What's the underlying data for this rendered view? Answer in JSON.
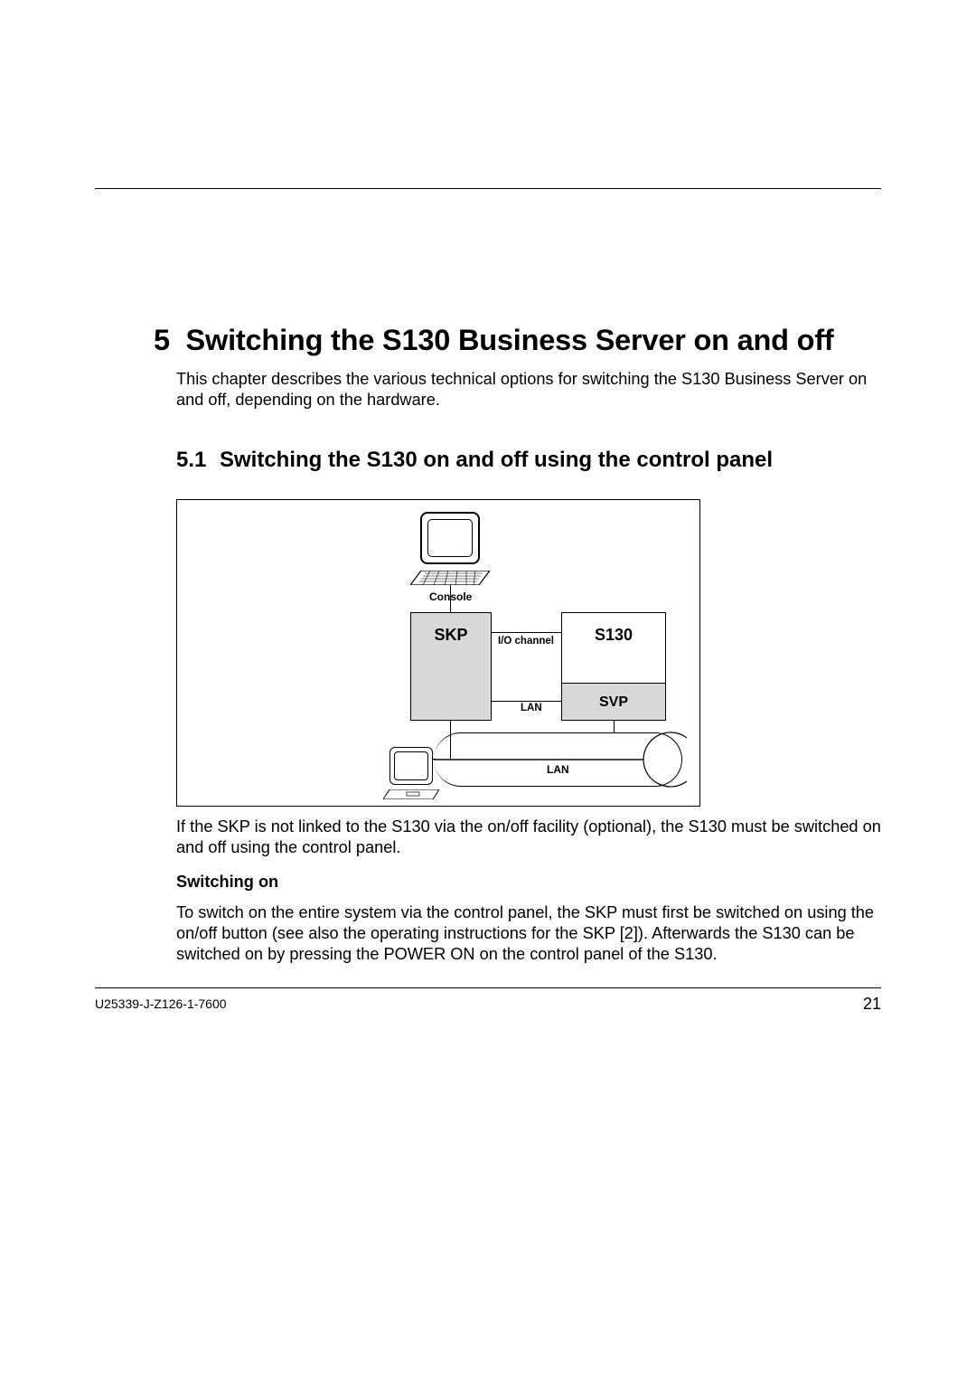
{
  "chapter": {
    "number": "5",
    "title": "Switching the S130 Business Server on and off"
  },
  "intro": "This chapter describes the various technical options for switching the S130 Business Server on and off, depending on the hardware.",
  "section": {
    "number": "5.1",
    "title": "Switching the S130 on and off using the control panel"
  },
  "diagram": {
    "console_label": "Console",
    "skp": "SKP",
    "s130": "S130",
    "svp": "SVP",
    "io_channel": "I/O channel",
    "lan1": "LAN",
    "lan2": "LAN"
  },
  "after_diagram": "If the SKP is not linked to the S130 via the on/off facility (optional), the S130 must be switched on and off using the control panel.",
  "switching_on": {
    "heading": "Switching on",
    "body": "To switch on the entire system via the control panel, the SKP must first be switched on using the on/off button (see also the operating instructions for the SKP [2]). Afterwards the S130 can be switched on by pressing the POWER ON on the control panel of the S130."
  },
  "footer": {
    "left": "U25339-J-Z126-1-7600",
    "right": "21"
  }
}
